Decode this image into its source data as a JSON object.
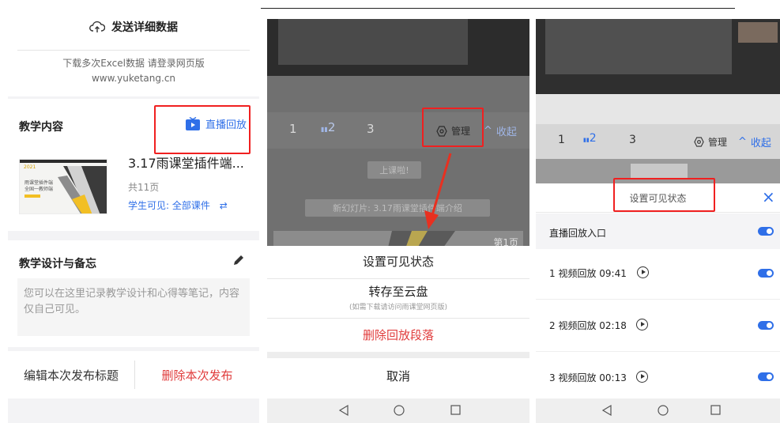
{
  "panel1": {
    "send_data_label": "发送详细数据",
    "download_hint": "下载多次Excel数据 请登录网页版",
    "website": "www.yuketang.cn",
    "teaching_content_title": "教学内容",
    "replay_label": "直播回放",
    "course": {
      "name": "3.17雨课堂插件端...",
      "pages": "共11页",
      "visibility": "学生可见: 全部课件",
      "thumb_year": "2021",
      "thumb_line1": "雨课堂插件端",
      "thumb_line2": "全国一教师端"
    },
    "design_title": "教学设计与备忘",
    "note_placeholder": "您可以在这里记录教学设计和心得等笔记，内容仅自己可见。",
    "edit_title_label": "编辑本次发布标题",
    "delete_publish_label": "删除本次发布"
  },
  "panel2": {
    "tabs": [
      "1",
      "2",
      "3"
    ],
    "manage_label": "管理",
    "collapse_label": "收起",
    "class_started_pill": "上课啦!",
    "new_slide_pill": "新幻灯片: 3.17雨课堂插件端介绍",
    "page_badge": "第1页",
    "sheet": {
      "set_visibility": "设置可见状态",
      "save_cloud": "转存至云盘",
      "save_cloud_note": "(如需下载请访问雨课堂网页版)",
      "delete_segment": "删除回放段落",
      "cancel": "取消"
    }
  },
  "panel3": {
    "tabs": [
      "1",
      "2",
      "3"
    ],
    "manage_label": "管理",
    "collapse_label": "收起",
    "header_title": "设置可见状态",
    "rows": [
      {
        "label": "直播回放入口",
        "has_play": false,
        "on": true
      },
      {
        "label": "1 视频回放 09:41",
        "has_play": true,
        "on": true
      },
      {
        "label": "2 视频回放 02:18",
        "has_play": true,
        "on": true
      },
      {
        "label": "3 视频回放 00:13",
        "has_play": true,
        "on": true
      }
    ]
  },
  "colors": {
    "accent_blue": "#2f6fe8",
    "danger_red": "#e03c3c",
    "highlight_red": "#f02020"
  },
  "icons": {
    "cloud_upload": "cloud-upload-icon",
    "tv": "tv-icon",
    "pen": "pen-icon",
    "swap": "swap-icon",
    "settings": "gear-icon",
    "chevron_up": "chevron-up-icon",
    "close": "close-icon",
    "play": "play-icon",
    "nav_back": "nav-back-icon",
    "nav_home": "nav-home-icon",
    "nav_recents": "nav-recents-icon"
  }
}
